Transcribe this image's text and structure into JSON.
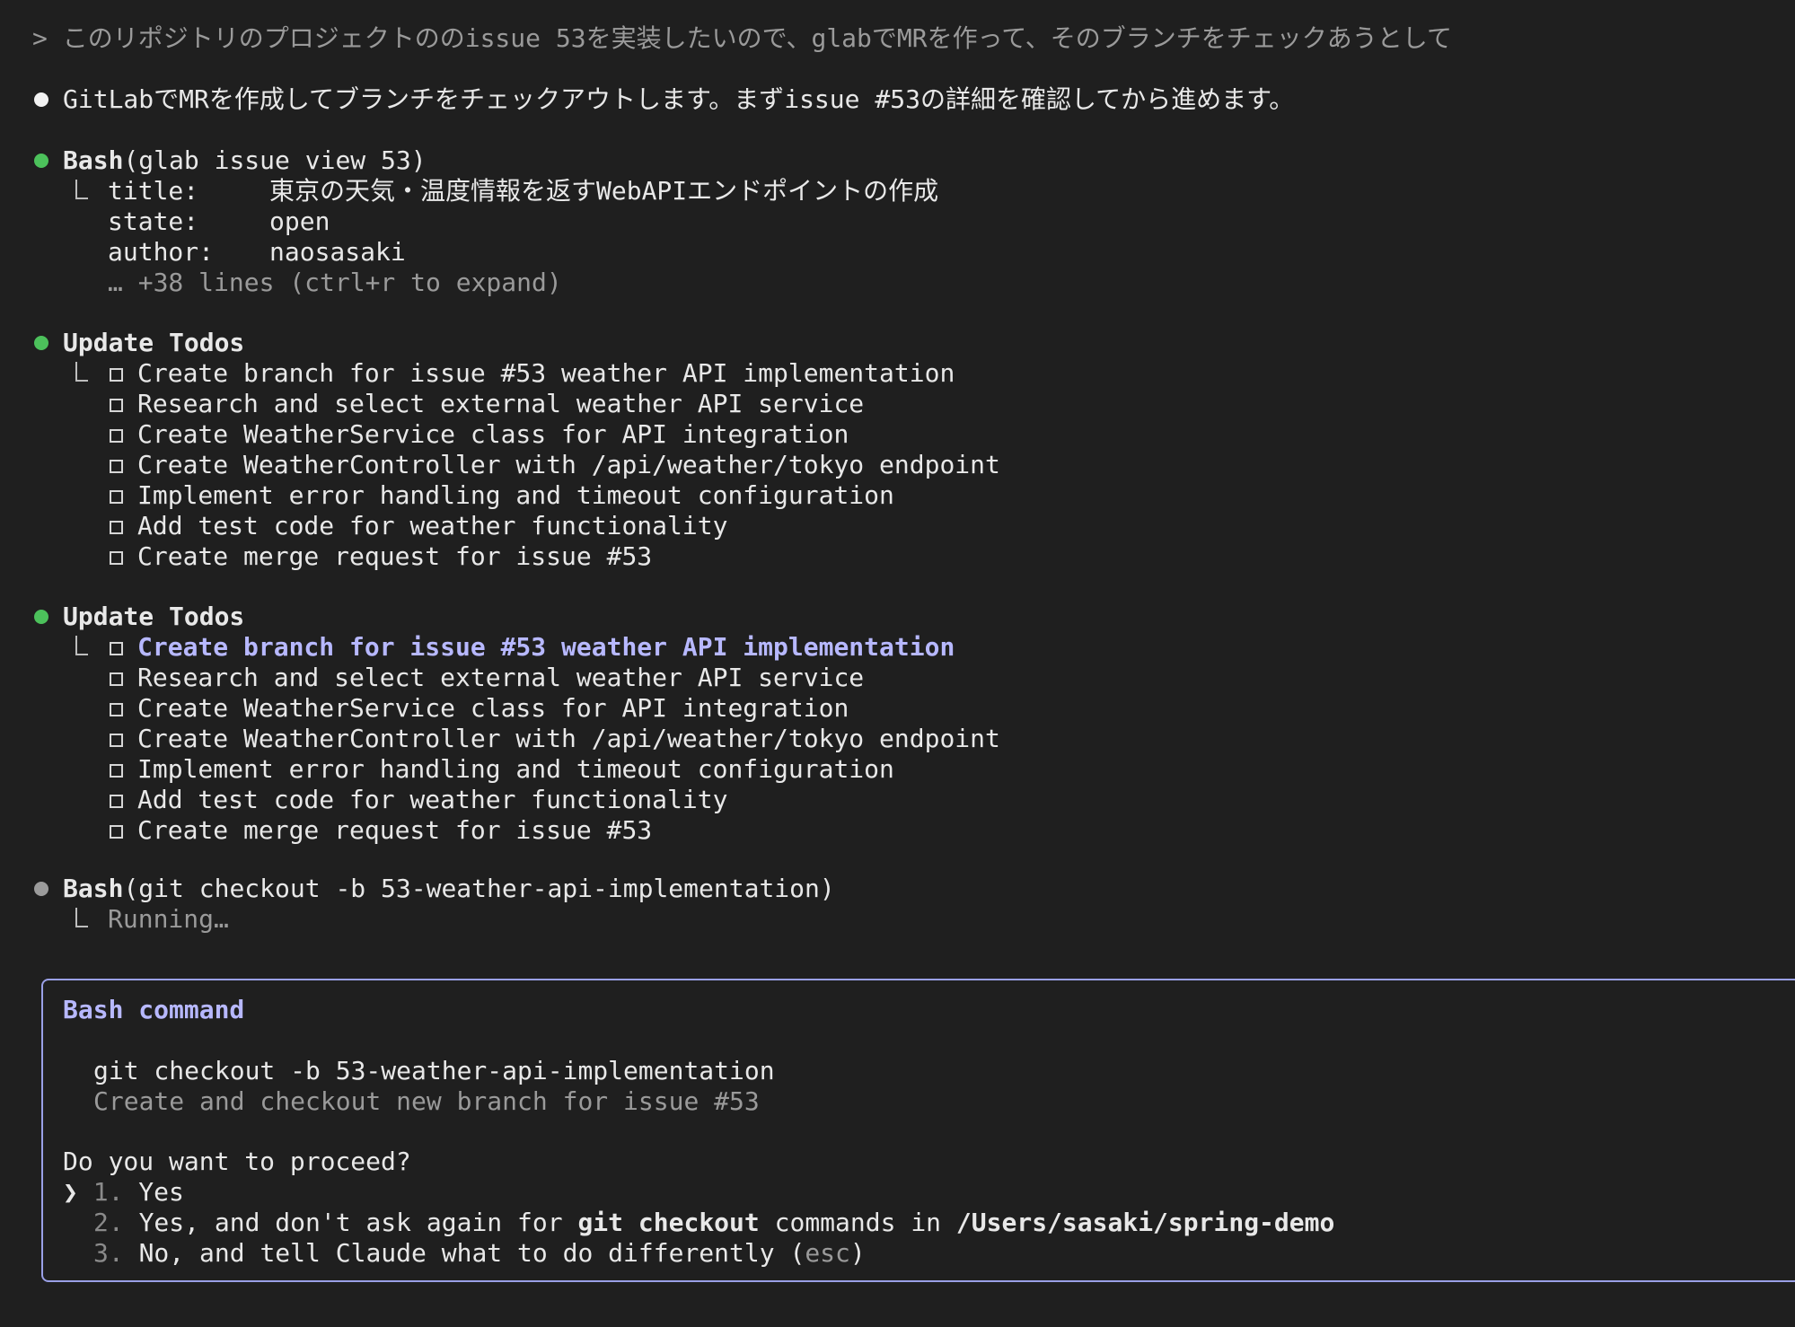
{
  "user_prompt": {
    "marker": ">",
    "text": "このリポジトリのプロジェクトののissue 53を実装したいので、glabでMRを作って、そのブランチをチェックあうとして"
  },
  "assistant_message": "GitLabでMRを作成してブランチをチェックアウトします。まずissue #53の詳細を確認してから進めます。",
  "tool_issue_view": {
    "name": "Bash",
    "args": "(glab issue view 53)",
    "output": [
      {
        "key": "title:",
        "value": "東京の天気・温度情報を返すWebAPIエンドポイントの作成"
      },
      {
        "key": "state:",
        "value": "open"
      },
      {
        "key": "author:",
        "value": "naosasaki"
      }
    ],
    "more": "… +38 lines (ctrl+r to expand)"
  },
  "todos_1": {
    "title": "Update Todos",
    "items": [
      "Create branch for issue #53 weather API implementation",
      "Research and select external weather API service",
      "Create WeatherService class for API integration",
      "Create WeatherController with /api/weather/tokyo endpoint",
      "Implement error handling and timeout configuration",
      "Add test code for weather functionality",
      "Create merge request for issue #53"
    ]
  },
  "todos_2": {
    "title": "Update Todos",
    "items": [
      "Create branch for issue #53 weather API implementation",
      "Research and select external weather API service",
      "Create WeatherService class for API integration",
      "Create WeatherController with /api/weather/tokyo endpoint",
      "Implement error handling and timeout configuration",
      "Add test code for weather functionality",
      "Create merge request for issue #53"
    ]
  },
  "tool_checkout": {
    "name": "Bash",
    "args": "(git checkout -b 53-weather-api-implementation)",
    "status": "Running…"
  },
  "permission_box": {
    "title": "Bash command",
    "command": "git checkout -b 53-weather-api-implementation",
    "description": "Create and checkout new branch for issue #53",
    "question": "Do you want to proceed?",
    "cursor": "❯",
    "option1_num": "1.",
    "option1_text": "Yes",
    "option2_num": "2.",
    "option2_pre": "Yes, and don't ask again for ",
    "option2_cmd": "git checkout",
    "option2_mid": " commands in ",
    "option2_path": "/Users/sasaki/spring-demo",
    "option3_num": "3.",
    "option3_pre": "No, and tell Claude what to do differently (",
    "option3_key": "esc",
    "option3_post": ")"
  },
  "colors": {
    "background": "#1f1f1f",
    "accent": "#b7b8ff",
    "success_bullet": "#4cc15b",
    "box_border": "#9aa0e6"
  }
}
